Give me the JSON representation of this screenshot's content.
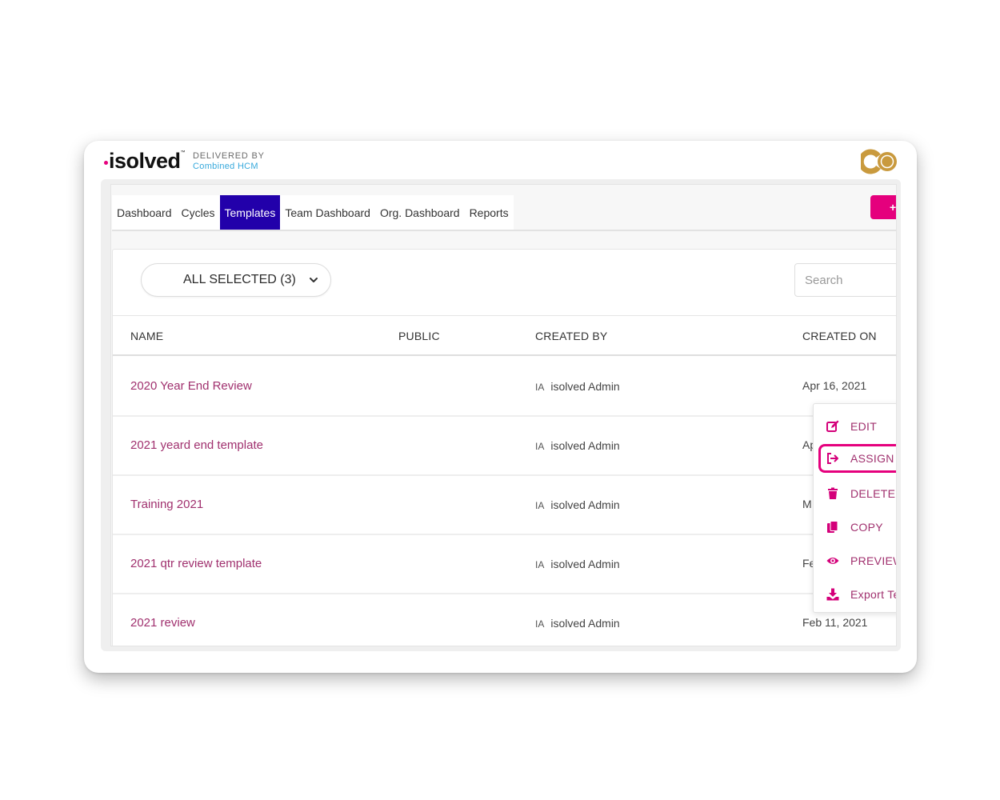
{
  "brand": {
    "logo_text": "isolved",
    "trademark": "™",
    "delivered_by": "DELIVERED BY",
    "partner": "Combined HCM",
    "partner_logo": "co-logo",
    "colors": {
      "accent": "#e5007d",
      "partner_blue": "#37a9dc",
      "partner_gold": "#c99a3e"
    }
  },
  "nav": {
    "tabs": [
      {
        "label": "Dashboard",
        "active": false
      },
      {
        "label": "Cycles",
        "active": false
      },
      {
        "label": "Templates",
        "active": true
      },
      {
        "label": "Team Dashboard",
        "active": false
      },
      {
        "label": "Org. Dashboard",
        "active": false
      },
      {
        "label": "Reports",
        "active": false
      }
    ],
    "active_color": "#2200aa",
    "add_button": {
      "icon": "plus-icon",
      "label": "+"
    }
  },
  "filter": {
    "label": "ALL SELECTED (3)",
    "icon": "chevron-down-icon"
  },
  "search": {
    "placeholder": "Search",
    "value": ""
  },
  "table": {
    "columns": [
      "NAME",
      "PUBLIC",
      "CREATED BY",
      "CREATED ON"
    ],
    "rows": [
      {
        "name": "2020 Year End Review",
        "public": "",
        "initials": "IA",
        "created_by": "isolved Admin",
        "created_on": "Apr 16, 2021"
      },
      {
        "name": "2021 yeard end template",
        "public": "",
        "initials": "IA",
        "created_by": "isolved Admin",
        "created_on": "Ap"
      },
      {
        "name": "Training 2021",
        "public": "",
        "initials": "IA",
        "created_by": "isolved Admin",
        "created_on": "M"
      },
      {
        "name": "2021 qtr review template",
        "public": "",
        "initials": "IA",
        "created_by": "isolved Admin",
        "created_on": "Fe"
      },
      {
        "name": "2021 review",
        "public": "",
        "initials": "IA",
        "created_by": "isolved Admin",
        "created_on": "Feb 11, 2021"
      }
    ]
  },
  "context_menu": {
    "items": [
      {
        "label": "EDIT",
        "icon": "edit-icon",
        "highlighted": false
      },
      {
        "label": "ASSIGN",
        "icon": "assign-icon",
        "highlighted": true
      },
      {
        "label": "DELETE",
        "icon": "trash-icon",
        "highlighted": false
      },
      {
        "label": "COPY",
        "icon": "copy-icon",
        "highlighted": false
      },
      {
        "label": "PREVIEW",
        "icon": "eye-icon",
        "highlighted": false
      },
      {
        "label": "Export Te",
        "icon": "download-icon",
        "highlighted": false
      }
    ]
  }
}
